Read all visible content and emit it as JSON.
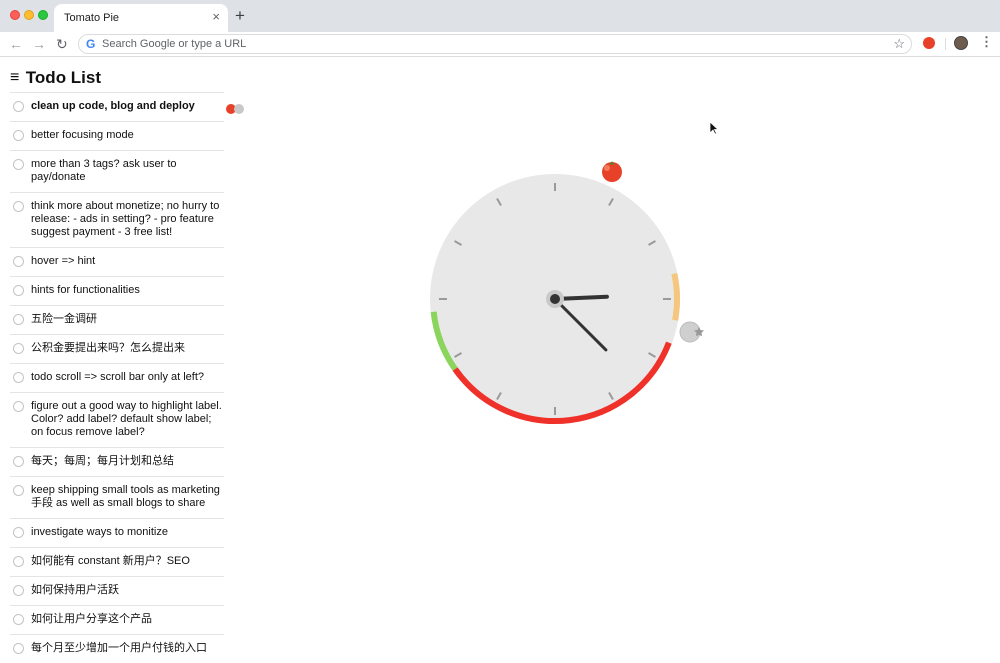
{
  "browser": {
    "tab_title": "Tomato Pie",
    "tab_close": "×",
    "new_tab": "+",
    "back_icon": "←",
    "forward_icon": "→",
    "reload_icon": "↻",
    "google_icon": "G",
    "omnibox_placeholder": "Search Google or type a URL",
    "star_icon": "☆",
    "menu_icon": "⋮"
  },
  "todo": {
    "menu_icon": "≡",
    "title": "Todo List",
    "items": [
      {
        "label": "clean up code, blog and deploy",
        "active": true
      },
      {
        "label": "better focusing mode"
      },
      {
        "label": "more than 3 tags? ask user to pay/donate"
      },
      {
        "label": "think more about monetize; no hurry to release: - ads in setting? - pro feature suggest payment - 3 free list!"
      },
      {
        "label": "hover => hint"
      },
      {
        "label": "hints for functionalities"
      },
      {
        "label": "五险一金调研"
      },
      {
        "label": "公积金要提出来吗？怎么提出来"
      },
      {
        "label": "todo scroll => scroll bar only at left?"
      },
      {
        "label": "figure out a good way to highlight label. Color? add label? default show label; on focus remove label?"
      },
      {
        "label": "每天；每周；每月计划和总结"
      },
      {
        "label": "keep shipping small tools as marketing 手段 as well as small blogs to share"
      },
      {
        "label": "investigate ways to monitize"
      },
      {
        "label": "如何能有 constant 新用户？SEO"
      },
      {
        "label": "如何保持用户活跃"
      },
      {
        "label": "如何让用户分享这个产品"
      },
      {
        "label": "每个月至少增加一个用户付钱的入口"
      }
    ]
  },
  "clock": {
    "face_color": "#e8e8e8",
    "focus_arc_color": "#f0312a",
    "break_arc_color": "#f5c77e",
    "green_arc_color": "#8bd55d",
    "tomato_color": "#e8412a",
    "hour": 3,
    "minute": 21
  }
}
